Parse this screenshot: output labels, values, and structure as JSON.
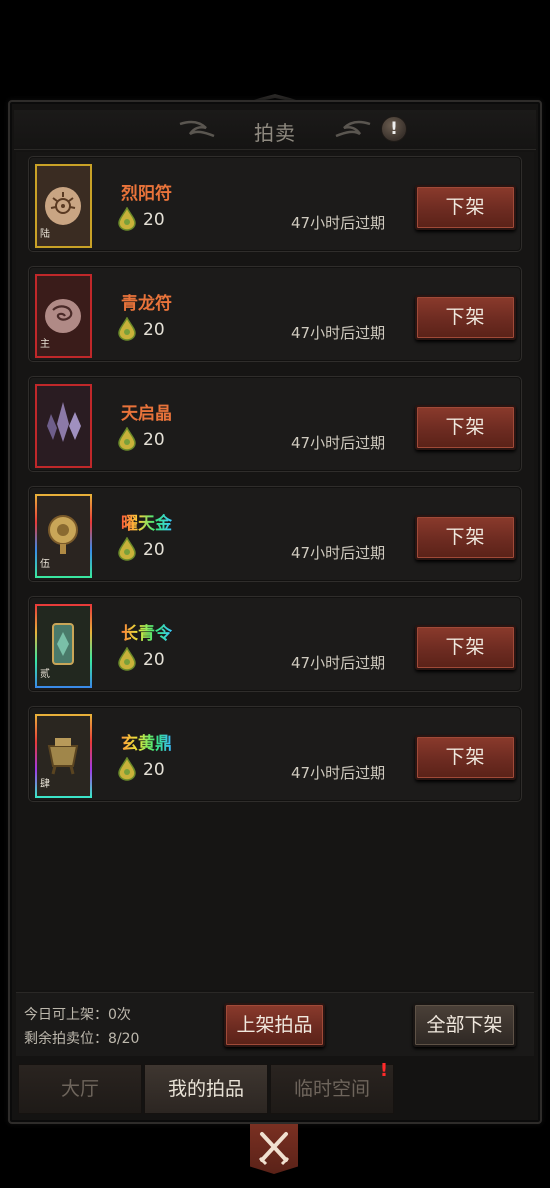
{
  "header": {
    "title": "拍卖"
  },
  "items": [
    {
      "name": "烈阳符",
      "tag": "陆",
      "price": "20",
      "expire": "47小时后过期",
      "button": "下架",
      "name_color": "#e8733a",
      "frame_color": "#c9a227",
      "icon": "sun-talisman-icon"
    },
    {
      "name": "青龙符",
      "tag": "主",
      "price": "20",
      "expire": "47小时后过期",
      "button": "下架",
      "name_color": "#e8733a",
      "frame_color": "#c0282a",
      "icon": "dragon-talisman-icon"
    },
    {
      "name": "天启晶",
      "tag": "",
      "price": "20",
      "expire": "47小时后过期",
      "button": "下架",
      "name_color": "#e8733a",
      "frame_color": "#c0282a",
      "icon": "crystal-icon"
    },
    {
      "name": "曜天金",
      "tag": "伍",
      "price": "20",
      "expire": "47小时后过期",
      "button": "下架",
      "name_color": "rainbow",
      "frame_color": "rainbow",
      "icon": "golden-medallion-icon"
    },
    {
      "name": "长青令",
      "tag": "贰",
      "price": "20",
      "expire": "47小时后过期",
      "button": "下架",
      "name_color": "rainbow",
      "frame_color": "rainbow",
      "icon": "jade-token-icon"
    },
    {
      "name": "玄黄鼎",
      "tag": "肆",
      "price": "20",
      "expire": "47小时后过期",
      "button": "下架",
      "name_color": "rainbow",
      "frame_color": "rainbow",
      "icon": "bronze-cauldron-icon"
    }
  ],
  "footer": {
    "today_listable": "今日可上架：0次",
    "remaining_slots": "剩余拍卖位：8/20",
    "list_button": "上架拍品",
    "delist_all_button": "全部下架"
  },
  "tabs": [
    {
      "label": "大厅",
      "active": false
    },
    {
      "label": "我的拍品",
      "active": true
    },
    {
      "label": "临时空间",
      "active": false,
      "badge": "!"
    }
  ],
  "colors": {
    "button_red": "#6b2a20",
    "panel_bg": "#141312",
    "item_bg": "#1c1b1a"
  }
}
